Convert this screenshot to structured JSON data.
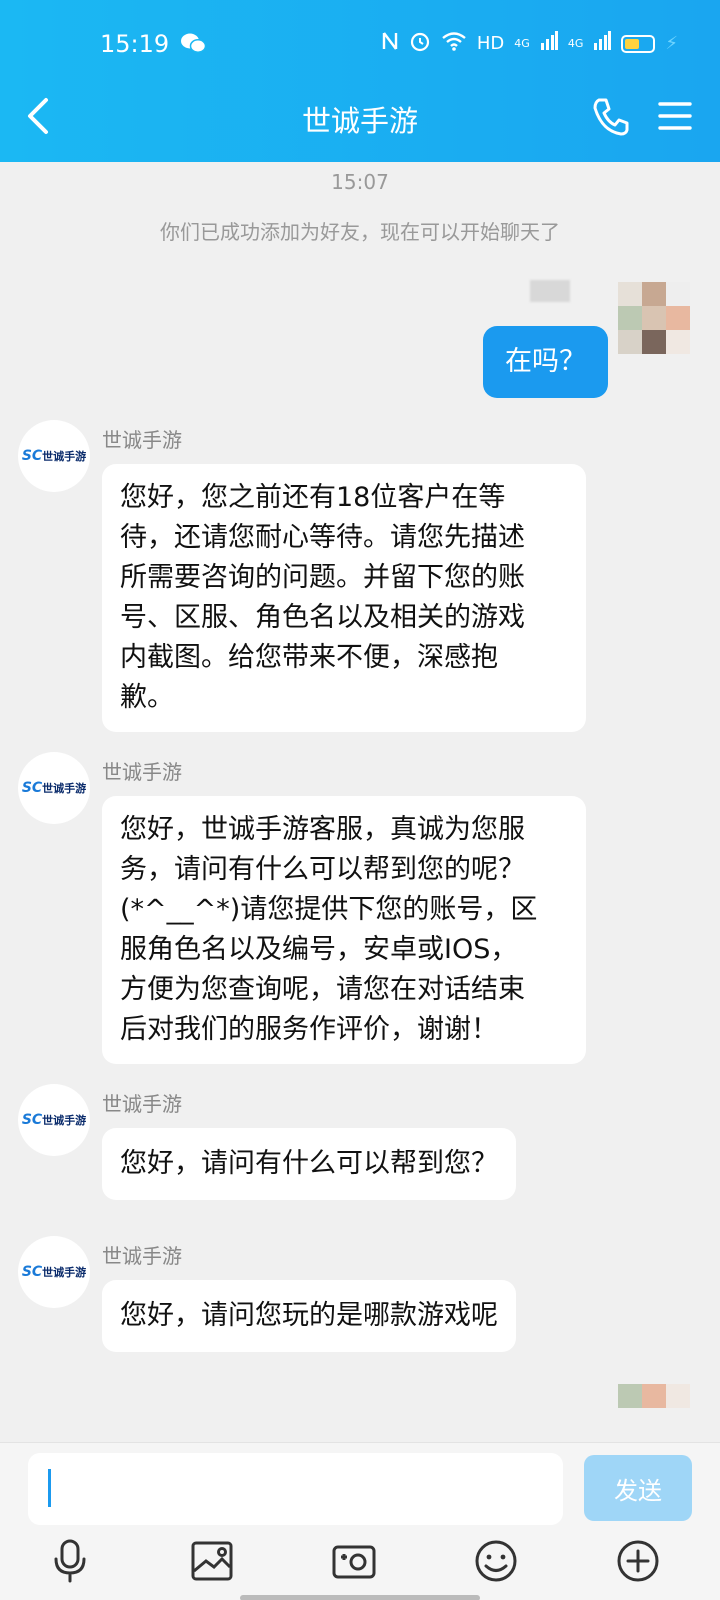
{
  "status": {
    "time": "15:19",
    "hd_label": "HD",
    "signal1": "4G",
    "signal2": "4G"
  },
  "header": {
    "title": "世诚手游"
  },
  "chat": {
    "timestamp": "15:07",
    "system_message": "你们已成功添加为好友，现在可以开始聊天了",
    "my_message": "在吗？",
    "messages": [
      {
        "sender": "世诚手游",
        "lines": [
          "您好，您之前还有18位客户在等",
          "待，还请您耐心等待。请您先描述",
          "所需要咨询的问题。并留下您的账",
          "号、区服、角色名以及相关的游戏",
          "内截图。给您带来不便，深感抱",
          "歉。"
        ]
      },
      {
        "sender": "世诚手游",
        "lines": [
          "您好，世诚手游客服，真诚为您服",
          "务，请问有什么可以帮到您的呢？",
          "(*^__^*)请您提供下您的账号，区",
          "服角色名以及编号，安卓或IOS，",
          "方便为您查询呢，请您在对话结束",
          "后对我们的服务作评价，谢谢！"
        ]
      },
      {
        "sender": "世诚手游",
        "lines": [
          "您好，请问有什么可以帮到您？"
        ]
      },
      {
        "sender": "世诚手游",
        "lines": [
          "您好，请问您玩的是哪款游戏呢"
        ]
      }
    ],
    "avatar_logo": {
      "mark": "SC",
      "text": "世诚手游"
    }
  },
  "input": {
    "value": "",
    "send_label": "发送"
  },
  "icons": [
    "microphone-icon",
    "image-icon",
    "camera-icon",
    "emoji-icon",
    "plus-icon"
  ],
  "colors": {
    "header": "#1aa6f0",
    "my_bubble": "#1b9aef",
    "send_disabled": "#9fd6f7"
  }
}
